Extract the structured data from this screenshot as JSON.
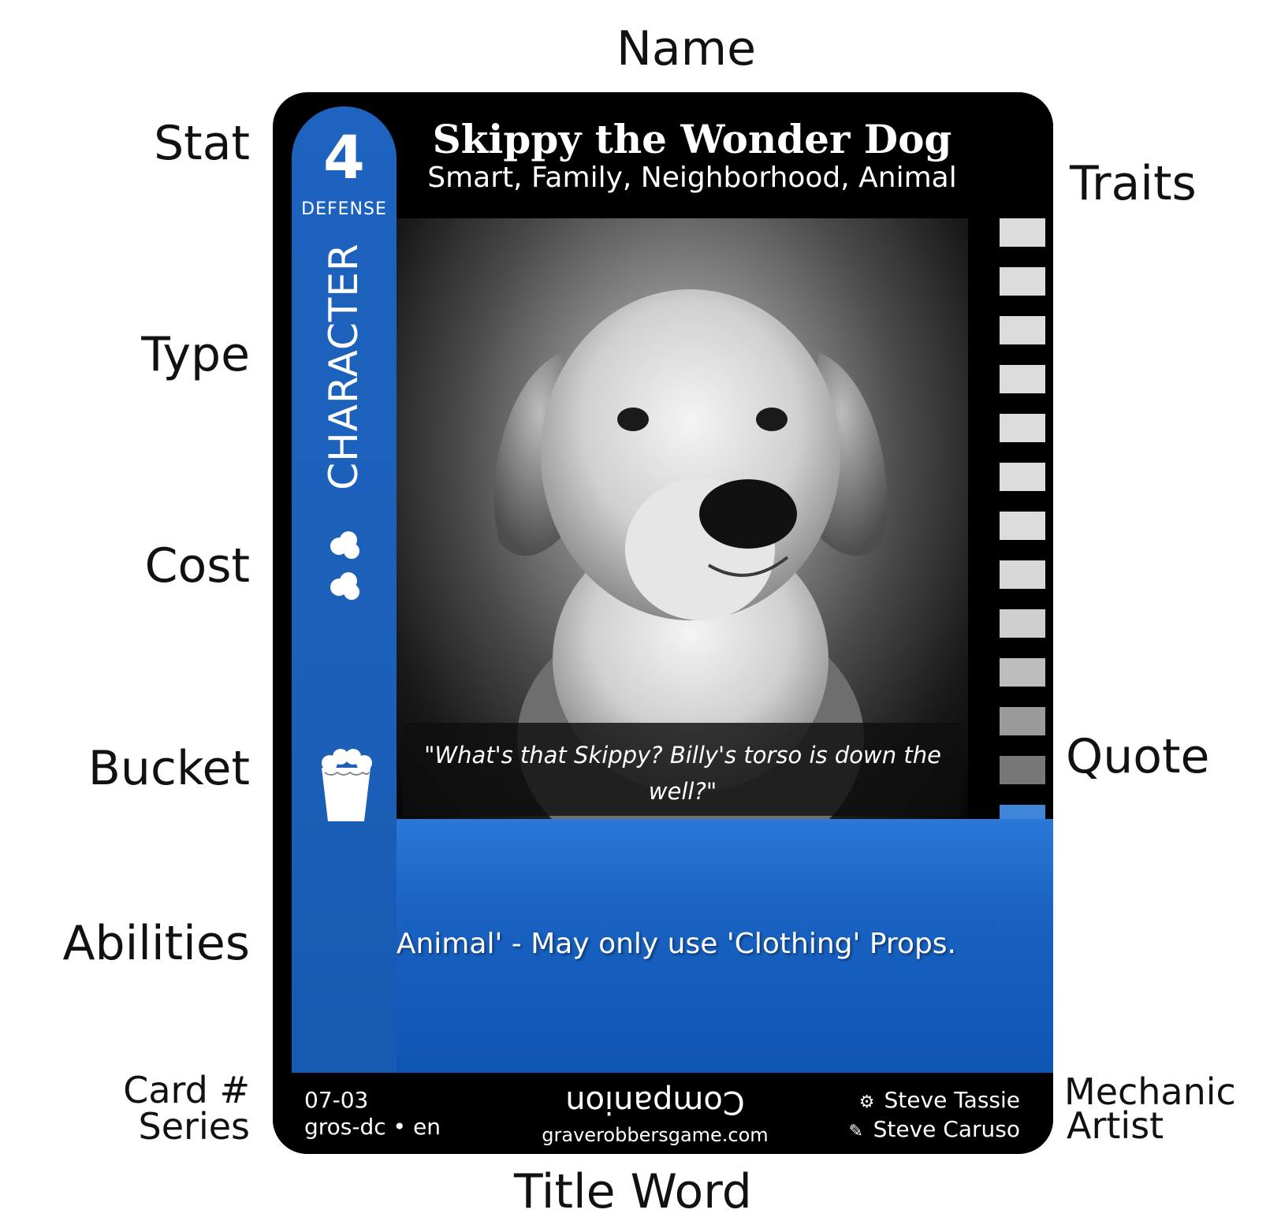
{
  "labels": {
    "name": "Name",
    "stat": "Stat",
    "traits": "Traits",
    "type": "Type",
    "cost": "Cost",
    "bucket": "Bucket",
    "quote": "Quote",
    "abilities": "Abilities",
    "card_number": "Card #",
    "series": "Series",
    "mechanic": "Mechanic",
    "artist": "Artist",
    "title_word": "Title Word"
  },
  "card": {
    "stat_value": "4",
    "stat_label": "DEFENSE",
    "type": "CHARACTER",
    "cost_count": 2,
    "name": "Skippy the Wonder Dog",
    "traits": "Smart, Family, Neighborhood, Animal",
    "quote": "\"What's that Skippy? Billy's torso is down the well?\"",
    "ability": "'Animal' - May only use 'Clothing' Props.",
    "card_number": "07-03",
    "series": "gros-dc • en",
    "title_word": "Companion",
    "website": "graverobbersgame.com",
    "mechanic": "Steve Tassie",
    "artist": "Steve Caruso",
    "mechanic_icon": "gear-icon",
    "artist_icon": "brush-icon",
    "art_subject": "dog-portrait",
    "colors": {
      "card_blue": "#1b5fb8",
      "card_black": "#000000"
    }
  }
}
